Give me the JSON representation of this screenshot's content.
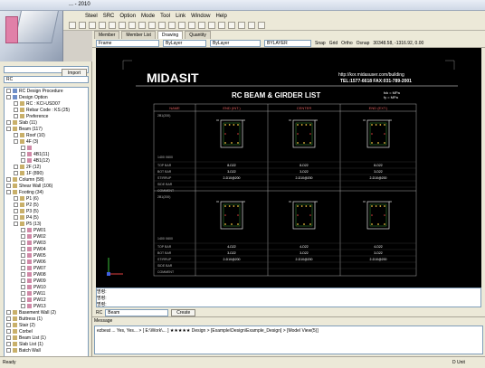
{
  "window": {
    "title": "... - 2010"
  },
  "menu": [
    "Steel",
    "SRC",
    "Option",
    "Mode",
    "Tool",
    "Link",
    "Window",
    "Help"
  ],
  "left": {
    "import_label": "Import",
    "rc_combo": "RC",
    "tree": [
      {
        "label": "RC Design Procedure",
        "level": 0,
        "icon": "b"
      },
      {
        "label": "Design Option",
        "level": 0,
        "icon": "b"
      },
      {
        "label": "RC : KCI-USD07",
        "level": 1,
        "icon": "y"
      },
      {
        "label": "Rebar Code : KS (25)",
        "level": 1,
        "icon": "y"
      },
      {
        "label": "Preference",
        "level": 1,
        "icon": "y"
      },
      {
        "label": "Slab (11)",
        "level": 0,
        "icon": "y"
      },
      {
        "label": "Beam (117)",
        "level": 0,
        "icon": "y"
      },
      {
        "label": "Roof (10)",
        "level": 1,
        "icon": "y"
      },
      {
        "label": "4F (3)",
        "level": 1,
        "icon": "y"
      },
      {
        "label": "",
        "level": 2,
        "icon": "p"
      },
      {
        "label": "4B1(11)",
        "level": 2,
        "icon": "p"
      },
      {
        "label": "4B1(12)",
        "level": 2,
        "icon": "p"
      },
      {
        "label": "2F (12)",
        "level": 1,
        "icon": "y"
      },
      {
        "label": "1F (890)",
        "level": 1,
        "icon": "y"
      },
      {
        "label": "Column (58)",
        "level": 0,
        "icon": "y"
      },
      {
        "label": "Shear Wall (106)",
        "level": 0,
        "icon": "y"
      },
      {
        "label": "Footing (34)",
        "level": 0,
        "icon": "y"
      },
      {
        "label": "P1 (6)",
        "level": 1,
        "icon": "y"
      },
      {
        "label": "P2 (5)",
        "level": 1,
        "icon": "y"
      },
      {
        "label": "P3 (5)",
        "level": 1,
        "icon": "y"
      },
      {
        "label": "P4 (5)",
        "level": 1,
        "icon": "y"
      },
      {
        "label": "P5 (13)",
        "level": 1,
        "icon": "y"
      },
      {
        "label": "PW01",
        "level": 2,
        "icon": "p"
      },
      {
        "label": "PW02",
        "level": 2,
        "icon": "p"
      },
      {
        "label": "PW03",
        "level": 2,
        "icon": "p"
      },
      {
        "label": "PW04",
        "level": 2,
        "icon": "p"
      },
      {
        "label": "PW05",
        "level": 2,
        "icon": "p"
      },
      {
        "label": "PW06",
        "level": 2,
        "icon": "p"
      },
      {
        "label": "PW07",
        "level": 2,
        "icon": "p"
      },
      {
        "label": "PW08",
        "level": 2,
        "icon": "p"
      },
      {
        "label": "PW09",
        "level": 2,
        "icon": "p"
      },
      {
        "label": "PW10",
        "level": 2,
        "icon": "p"
      },
      {
        "label": "PW11",
        "level": 2,
        "icon": "p"
      },
      {
        "label": "PW12",
        "level": 2,
        "icon": "p"
      },
      {
        "label": "PW13",
        "level": 2,
        "icon": "p"
      },
      {
        "label": "Basement Wall (2)",
        "level": 0,
        "icon": "y"
      },
      {
        "label": "Buttress (1)",
        "level": 0,
        "icon": "y"
      },
      {
        "label": "Stair (2)",
        "level": 0,
        "icon": "y"
      },
      {
        "label": "Corbel",
        "level": 0,
        "icon": "y"
      },
      {
        "label": "Beam List (1)",
        "level": 0,
        "icon": "y"
      },
      {
        "label": "Slab List (1)",
        "level": 0,
        "icon": "y"
      },
      {
        "label": "Batch Wall",
        "level": 0,
        "icon": "y"
      }
    ]
  },
  "doc": {
    "tabs": [
      "Member",
      "Member List",
      "Drawing",
      "Quantity"
    ],
    "active_tab": 2,
    "frame_combo": "Frame",
    "layer_combo": "ByLayer",
    "linetype_combo": "ByLayer",
    "lineweight_combo": "BYLAYER",
    "snap_items": [
      "Snap",
      "Grid",
      "Ortho",
      "Osnap",
      "30348.58, -1316.92, 0.00"
    ]
  },
  "drawing": {
    "logo": "MIDASIT",
    "web": "http://kor.midasuser.com/building",
    "tel": "TEL:1577-6618  FAX:031-789-2001",
    "title": "RC BEAM & GIRDER LIST",
    "grade1": "fck =      MPa",
    "grade2": "fy  =      MPa",
    "headers": [
      "NAME",
      "END (INT.)",
      "CENTER",
      "END (EXT.)"
    ],
    "section_a": "2B1(200)",
    "section_b": "2B1(200)",
    "dims1": "1400 X600",
    "dims2": "1400 X600",
    "row_labels": [
      "TOP BAR",
      "BOT BAR",
      "STIRRUP",
      "SIDE BAR",
      "COMMENT"
    ],
    "row_values": [
      [
        "8-D22",
        "8-D22",
        "8-D22"
      ],
      [
        "3-D22",
        "3-D22",
        "3-D22"
      ],
      [
        "2-D10@200",
        "2-D10@200",
        "2-D10@200"
      ],
      [
        "",
        "",
        ""
      ],
      [
        "",
        "",
        ""
      ]
    ],
    "row_values_b": [
      [
        "4-D22",
        "4-D22",
        "4-D22"
      ],
      [
        "3-D22",
        "3-D22",
        "3-D22"
      ],
      [
        "2-D10@200",
        "2-D10@200",
        "2-D10@200"
      ],
      [
        "",
        "",
        ""
      ],
      [
        "",
        "",
        ""
      ]
    ]
  },
  "command": {
    "lines": [
      "명령:",
      "명령:",
      "명령:"
    ],
    "combo": "Beam",
    "create_label": "Create",
    "prefix": "RC"
  },
  "message": {
    "title": "Message",
    "text": "ezbeat ... Yes, Yes... > [ E:\\Work\\... ] ★★★★★ Design > [Example\\Design\\Example_Design] > [Model View(5)]"
  },
  "status": {
    "left": "Ready",
    "right": "D Unit"
  }
}
